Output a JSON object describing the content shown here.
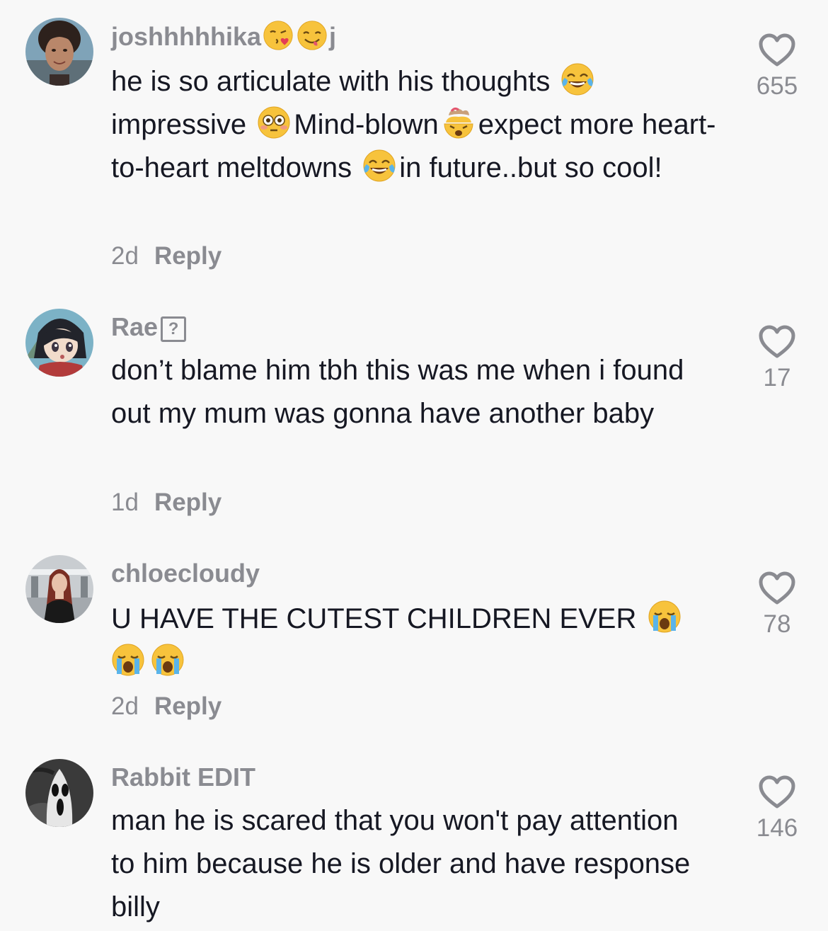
{
  "comments": [
    {
      "username": "joshhhhhika",
      "username_suffix": "j",
      "text_parts": [
        "he is so articulate with his thoughts ",
        " impressive ",
        "Mind-blown",
        "expect more heart-to-heart meltdowns ",
        "in future..but so cool!"
      ],
      "age": "2d",
      "reply": "Reply",
      "likes": "655"
    },
    {
      "username": "Rae",
      "username_box": "?",
      "text": "don’t blame him tbh this was me when i found out my mum was gonna have another baby",
      "age": "1d",
      "reply": "Reply",
      "likes": "17"
    },
    {
      "username": "chloecloudy",
      "text": "U HAVE THE CUTEST CHILDREN EVER",
      "age": "2d",
      "reply": "Reply",
      "likes": "78"
    },
    {
      "username": "Rabbit EDIT",
      "text": "man he is scared that you won't pay attention to him because he is older and have response billy",
      "likes": "146"
    }
  ],
  "icons": {
    "like": "heart-outline-icon",
    "emoji_kiss": "face-blowing-kiss-emoji",
    "emoji_yum": "face-savoring-food-emoji",
    "emoji_laugh": "face-with-tears-of-joy-emoji",
    "emoji_flushed": "flushed-face-emoji",
    "emoji_exploding": "exploding-head-emoji",
    "emoji_crying": "loudly-crying-face-emoji"
  },
  "colors": {
    "background": "#f8f8f8",
    "text": "#161823",
    "muted": "#8a8b91"
  }
}
